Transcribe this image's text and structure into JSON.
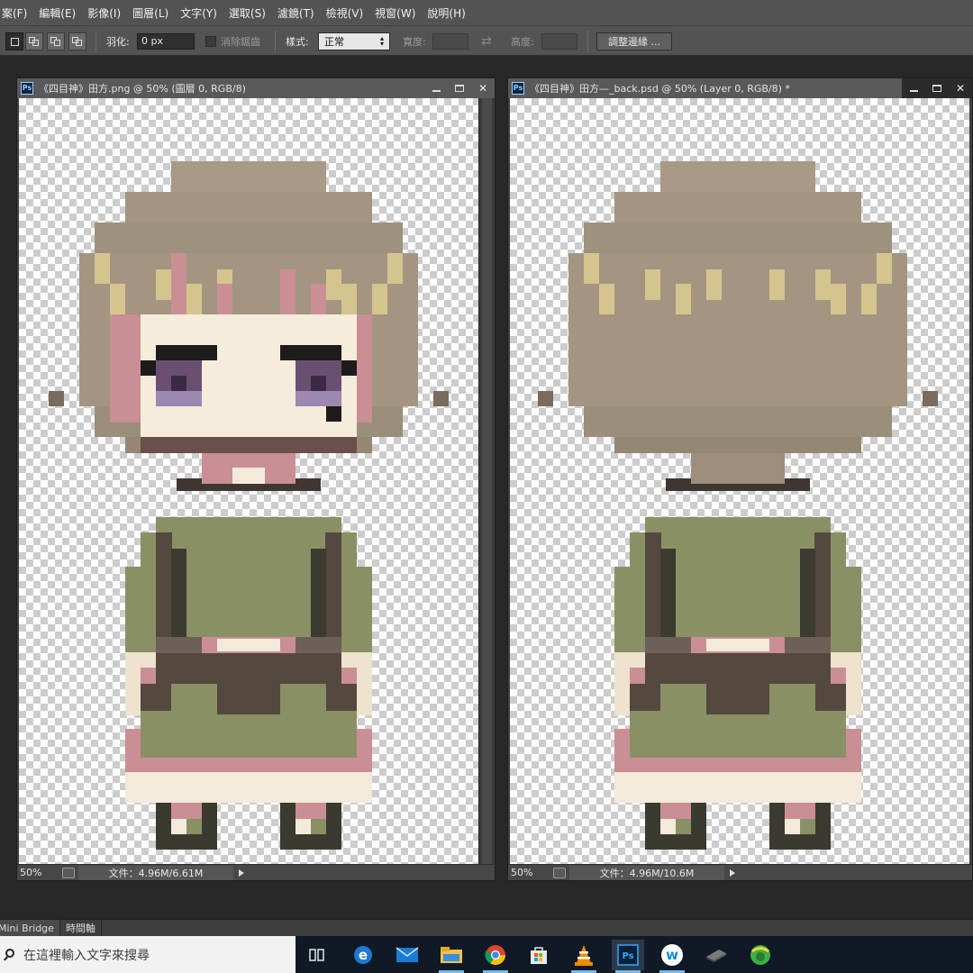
{
  "menubar": {
    "items": [
      "案(F)",
      "編輯(E)",
      "影像(I)",
      "圖層(L)",
      "文字(Y)",
      "選取(S)",
      "濾鏡(T)",
      "檢視(V)",
      "視窗(W)",
      "說明(H)"
    ]
  },
  "options_bar": {
    "feather_label": "羽化:",
    "feather_value": "0 px",
    "antialias_label": "消除鋸齒",
    "style_label": "樣式:",
    "style_value": "正常",
    "width_label": "寬度:",
    "height_label": "高度:",
    "refine_button": "調整邊緣 ..."
  },
  "documents": [
    {
      "title": "《四目神》田方.png @ 50% (圖層 0, RGB/8)",
      "zoom": "50%",
      "doc_size": "文件：4.96M/6.61M",
      "view": "front"
    },
    {
      "title": "《四目神》田方—_back.psd @ 50% (Layer 0, RGB/8) *",
      "zoom": "50%",
      "doc_size": "文件：4.96M/10.6M",
      "view": "back"
    }
  ],
  "bottom_panel": {
    "tabs": [
      "Mini Bridge",
      "時間軸"
    ]
  },
  "taskbar": {
    "search_placeholder": "在這裡輸入文字來搜尋",
    "apps": [
      "task-view",
      "edge",
      "mail",
      "file-explorer",
      "chrome",
      "store",
      "vlc",
      "photoshop",
      "app-w",
      "app-dark",
      "app-green"
    ]
  },
  "colors": {
    "hair": "#a39581",
    "hair_light": "#d6c48e",
    "skin": "#f5ecdc",
    "pink": "#c98f95",
    "green": "#8a9066",
    "dark_brown": "#55483f",
    "eye_purple": "#6a4f73"
  }
}
